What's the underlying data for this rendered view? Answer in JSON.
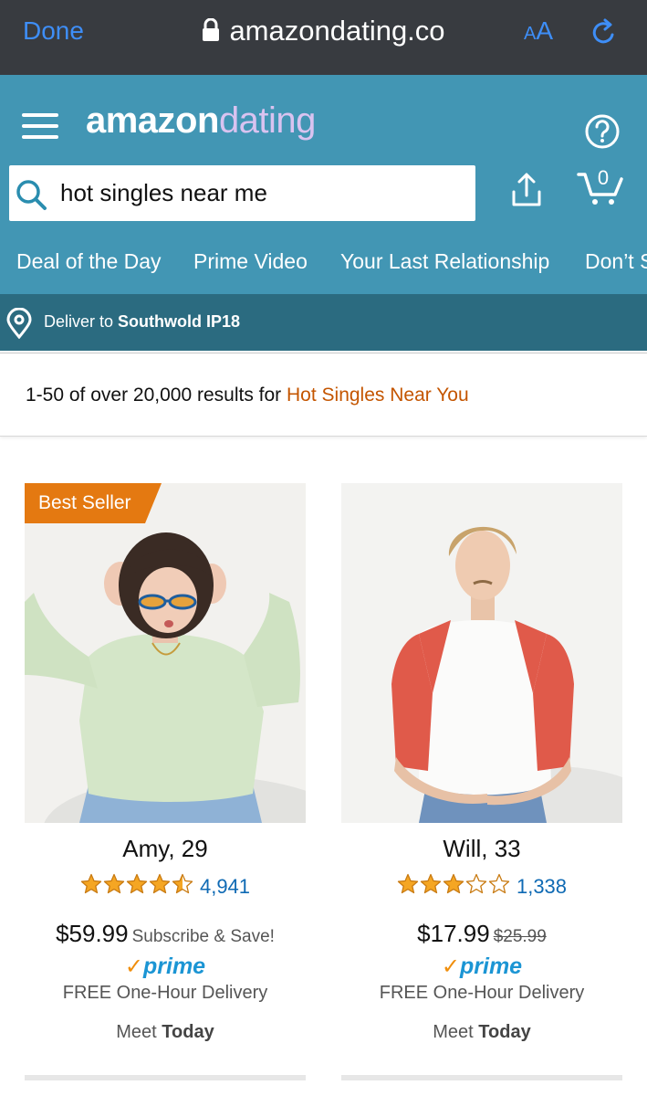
{
  "browser": {
    "done_label": "Done",
    "url": "amazondating.co",
    "text_size_small": "A",
    "text_size_large": "A",
    "icons": [
      "lock-icon",
      "reload-icon"
    ]
  },
  "header": {
    "logo_part1": "amazon",
    "logo_part2": "dating",
    "search_value": "hot singles near me",
    "cart_count": "0",
    "icons": [
      "menu-icon",
      "help-icon",
      "search-icon",
      "share-icon",
      "cart-icon"
    ],
    "colors": {
      "header_bg": "#4296b4",
      "deliver_bg": "#2b6b80",
      "browser_bg": "#383b40"
    }
  },
  "nav": {
    "items": [
      "Deal of the Day",
      "Prime Video",
      "Your Last Relationship",
      "Don’t S"
    ]
  },
  "deliver": {
    "prefix": "Deliver to",
    "location": "Southwold IP18"
  },
  "results": {
    "summary": "1-50 of over 20,000 results for",
    "query": "Hot Singles Near You"
  },
  "products": [
    {
      "badge": "Best Seller",
      "name": "Amy, 29",
      "rating": 4.5,
      "rating_count": "4,941",
      "price": "$59.99",
      "price_note": "Subscribe & Save!",
      "prime": "prime",
      "delivery": "FREE One-Hour Delivery",
      "meet_prefix": "Meet",
      "meet_when": "Today"
    },
    {
      "name": "Will, 33",
      "rating": 3,
      "rating_count": "1,338",
      "price": "$17.99",
      "price_old": "$25.99",
      "prime": "prime",
      "delivery": "FREE One-Hour Delivery",
      "meet_prefix": "Meet",
      "meet_when": "Today"
    }
  ]
}
